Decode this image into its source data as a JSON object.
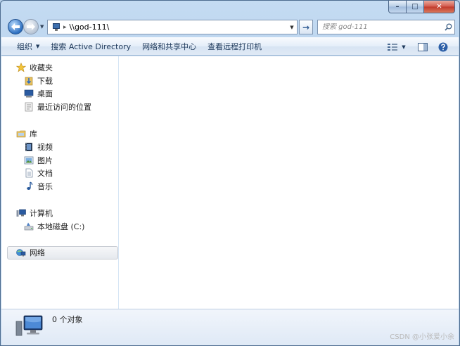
{
  "window": {
    "caption_buttons": {
      "minimize": "–",
      "maximize": "□",
      "close": "✕"
    }
  },
  "address_bar": {
    "path": "\\\\god-111\\",
    "separator": "▸",
    "dropdown": "▼",
    "go_icon": "→"
  },
  "search": {
    "placeholder": "搜索 god-111"
  },
  "toolbar": {
    "organize": "组织",
    "search_ad": "搜索 Active Directory",
    "network_center": "网络和共享中心",
    "view_printers": "查看远程打印机",
    "dropdown_arrow": "▼"
  },
  "nav_pane": {
    "favorites": {
      "label": "收藏夹",
      "items": [
        "下载",
        "桌面",
        "最近访问的位置"
      ]
    },
    "libraries": {
      "label": "库",
      "items": [
        "视频",
        "图片",
        "文档",
        "音乐"
      ]
    },
    "computer": {
      "label": "计算机",
      "items": [
        "本地磁盘 (C:)"
      ]
    },
    "network": {
      "label": "网络"
    }
  },
  "details": {
    "status": "0 个对象"
  },
  "watermark": "CSDN @小张爱小余",
  "colors": {
    "frame": "#b9d1ea",
    "toolbar_text": "#1e395b",
    "selection_border": "#c8ccd3"
  }
}
